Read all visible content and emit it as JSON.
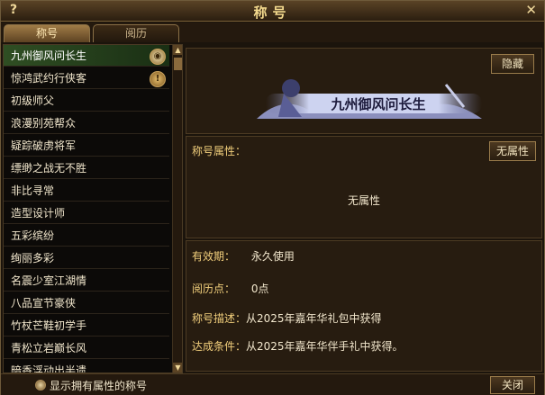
{
  "window": {
    "title": "称号",
    "help_label": "?",
    "close_label": "✕"
  },
  "tabs": [
    {
      "label": "称号"
    },
    {
      "label": "阅历"
    }
  ],
  "titles_list": [
    {
      "label": "九州御风问长生"
    },
    {
      "label": "惊鸿武约行侠客"
    },
    {
      "label": "初级师父"
    },
    {
      "label": "浪漫别苑帮众"
    },
    {
      "label": "疑踪破虏将军"
    },
    {
      "label": "缥缈之战无不胜"
    },
    {
      "label": "非比寻常"
    },
    {
      "label": "造型设计师"
    },
    {
      "label": "五彩缤纷"
    },
    {
      "label": "绚丽多彩"
    },
    {
      "label": "名震少室江湖情"
    },
    {
      "label": "八品宣节豪侠"
    },
    {
      "label": "竹杖芒鞋初学手"
    },
    {
      "label": "青松立岩巅长风"
    },
    {
      "label": "暗香浮动出半遗"
    }
  ],
  "detail": {
    "hide_button": "隐藏",
    "banner_text": "九州御风问长生",
    "attr_label": "称号属性：",
    "attr_button": "无属性",
    "attr_value": "无属性",
    "validity_key": "有效期：",
    "validity_value": "永久使用",
    "exp_key": "阅历点：",
    "exp_value": "0点",
    "desc_key": "称号描述：",
    "desc_value": "从2025年嘉年华礼包中获得",
    "cond_key": "达成条件：",
    "cond_value": "从2025年嘉年华伴手礼中获得。"
  },
  "footer": {
    "show_attr_label": "显示拥有属性的称号",
    "close_button": "关闭"
  }
}
